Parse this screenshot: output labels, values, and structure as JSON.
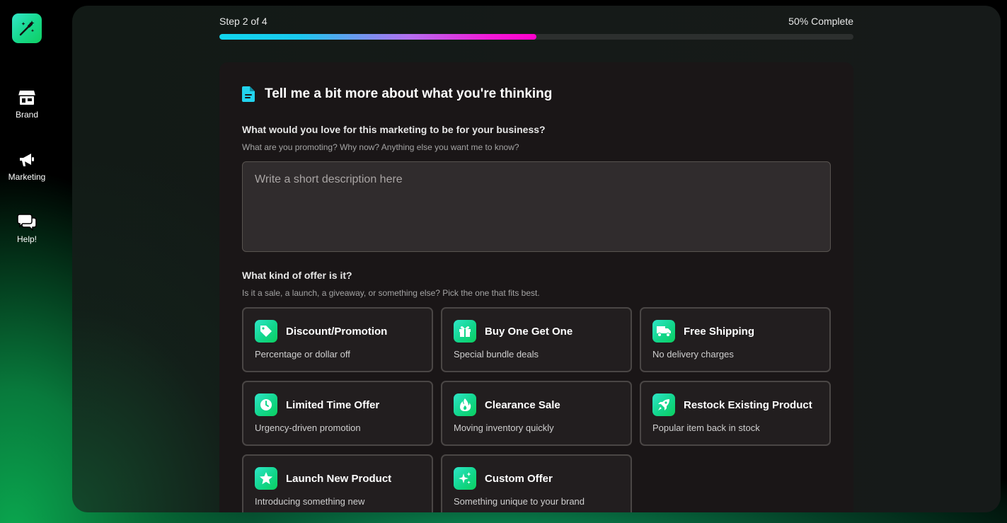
{
  "sidebar": {
    "logo_icon": "magic-wand-icon",
    "items": [
      {
        "label": "Brand",
        "icon": "store-icon"
      },
      {
        "label": "Marketing",
        "icon": "megaphone-icon"
      },
      {
        "label": "Help!",
        "icon": "chat-bubbles-icon"
      }
    ]
  },
  "progress": {
    "step_text": "Step 2 of 4",
    "complete_text": "50% Complete",
    "fraction": 0.5
  },
  "form": {
    "title": "Tell me a bit more about what you're thinking",
    "title_icon": "document-icon",
    "description_question": "What would you love for this marketing to be for your business?",
    "description_help": "What are you promoting? Why now? Anything else you want me to know?",
    "description_placeholder": "Write a short description here",
    "description_value": "",
    "offer_question": "What kind of offer is it?",
    "offer_help": "Is it a sale, a launch, a giveaway, or something else? Pick the one that fits best.",
    "offers": [
      {
        "title": "Discount/Promotion",
        "subtitle": "Percentage or dollar off",
        "icon": "tag-icon"
      },
      {
        "title": "Buy One Get One",
        "subtitle": "Special bundle deals",
        "icon": "gift-icon"
      },
      {
        "title": "Free Shipping",
        "subtitle": "No delivery charges",
        "icon": "truck-icon"
      },
      {
        "title": "Limited Time Offer",
        "subtitle": "Urgency-driven promotion",
        "icon": "clock-icon"
      },
      {
        "title": "Clearance Sale",
        "subtitle": "Moving inventory quickly",
        "icon": "fire-icon"
      },
      {
        "title": "Restock Existing Product",
        "subtitle": "Popular item back in stock",
        "icon": "rocket-icon"
      },
      {
        "title": "Launch New Product",
        "subtitle": "Introducing something new",
        "icon": "star-icon"
      },
      {
        "title": "Custom Offer",
        "subtitle": "Something unique to your brand",
        "icon": "sparkles-icon"
      }
    ]
  },
  "colors": {
    "accent_start": "#11d6ee",
    "accent_end": "#ff00cc",
    "icon_green": "#12d68c",
    "title_icon": "#22d3ee"
  }
}
